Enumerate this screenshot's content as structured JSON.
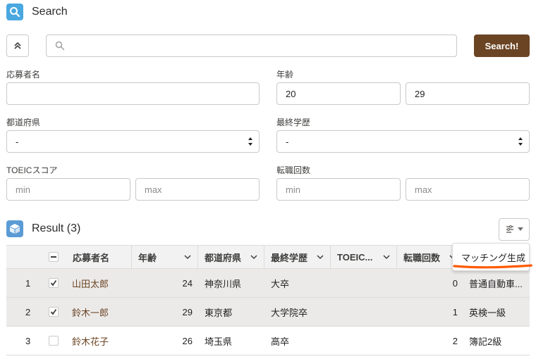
{
  "search_section": {
    "title": "Search",
    "search_button": "Search!",
    "search_placeholder": ""
  },
  "filters": {
    "applicant_name": {
      "label": "応募者名",
      "value": ""
    },
    "age": {
      "label": "年齢",
      "from": "20",
      "to": "29"
    },
    "prefecture": {
      "label": "都道府県",
      "value": "-"
    },
    "education": {
      "label": "最終学歴",
      "value": "-"
    },
    "toeic": {
      "label": "TOEICスコア",
      "min_placeholder": "min",
      "max_placeholder": "max"
    },
    "job_changes": {
      "label": "転職回数",
      "min_placeholder": "min",
      "max_placeholder": "max"
    }
  },
  "result": {
    "title": "Result (3)",
    "columns": {
      "name": "応募者名",
      "age": "年齢",
      "prefecture": "都道府県",
      "education": "最終学歴",
      "toeic": "TOEIC...",
      "job_changes": "転職回数"
    },
    "rows": [
      {
        "index": "1",
        "checked": true,
        "name": "山田太郎",
        "age": "24",
        "prefecture": "神奈川県",
        "education": "大卒",
        "toeic": "",
        "job_changes": "0",
        "license": "普通自動車..."
      },
      {
        "index": "2",
        "checked": true,
        "name": "鈴木一郎",
        "age": "29",
        "prefecture": "東京都",
        "education": "大学院卒",
        "toeic": "",
        "job_changes": "1",
        "license": "英検一級"
      },
      {
        "index": "3",
        "checked": false,
        "name": "鈴木花子",
        "age": "26",
        "prefecture": "埼玉県",
        "education": "高卒",
        "toeic": "",
        "job_changes": "2",
        "license": "簿記2級"
      }
    ],
    "menu_item": "マッチング生成"
  },
  "colors": {
    "search_icon_bg": "#4aa8e0",
    "result_icon_bg": "#5b9bd5",
    "brand_button": "#6b4423",
    "link": "#6b4423",
    "annotation_underline": "#ff5a00"
  }
}
